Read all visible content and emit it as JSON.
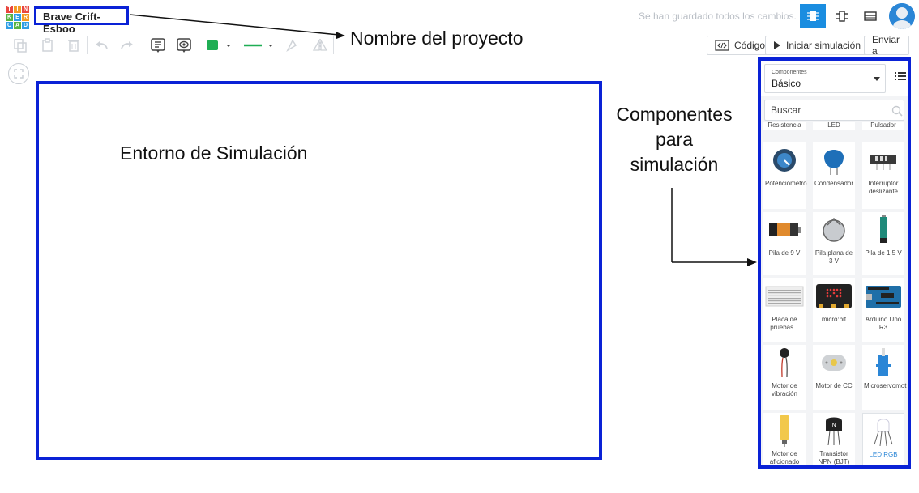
{
  "header": {
    "logo_letters": [
      "T",
      "I",
      "N",
      "K",
      "E",
      "R",
      "C",
      "A",
      "D"
    ],
    "project_name": "Brave Crift-Esboo",
    "save_status": "Se han guardado todos los cambios."
  },
  "toolbar": {
    "code_label": "Código",
    "simulate_label": "Iniciar simulación",
    "send_label": "Enviar a",
    "shape_color": "#1fae54",
    "wire_color": "#1fae54"
  },
  "annotations": {
    "project_name": "Nombre del proyecto",
    "sim_area": "Entorno de Simulación",
    "components": [
      "Componentes",
      "para",
      "simulación"
    ]
  },
  "panel": {
    "dropdown_caption": "Componentes",
    "dropdown_value": "Básico",
    "search_placeholder": "Buscar",
    "partial_labels": [
      "Resistencia",
      "LED",
      "Pulsador"
    ],
    "components": [
      {
        "label": "Potenciómetro",
        "icon": "potentiometer-icon"
      },
      {
        "label": "Condensador",
        "icon": "capacitor-icon"
      },
      {
        "label": "Interruptor deslizante",
        "icon": "slide-switch-icon"
      },
      {
        "label": "Pila de 9 V",
        "icon": "battery-9v-icon"
      },
      {
        "label": "Pila plana de 3 V",
        "icon": "coin-cell-icon"
      },
      {
        "label": "Pila de 1,5 V",
        "icon": "battery-aa-icon"
      },
      {
        "label": "Placa de pruebas...",
        "icon": "breadboard-icon"
      },
      {
        "label": "micro:bit",
        "icon": "microbit-icon"
      },
      {
        "label": "Arduino Uno R3",
        "icon": "arduino-icon"
      },
      {
        "label": "Motor de vibración",
        "icon": "vibration-motor-icon"
      },
      {
        "label": "Motor de CC",
        "icon": "dc-motor-icon"
      },
      {
        "label": "Microservomot",
        "icon": "micro-servo-icon"
      },
      {
        "label": "Motor de aficionado",
        "icon": "hobby-gearmotor-icon"
      },
      {
        "label": "Transistor NPN (BJT)",
        "icon": "npn-transistor-icon"
      },
      {
        "label": "LED RGB",
        "icon": "rgb-led-icon"
      }
    ],
    "colors": {
      "accent": "#2b86d6",
      "highlight": "#0a22d6"
    }
  }
}
